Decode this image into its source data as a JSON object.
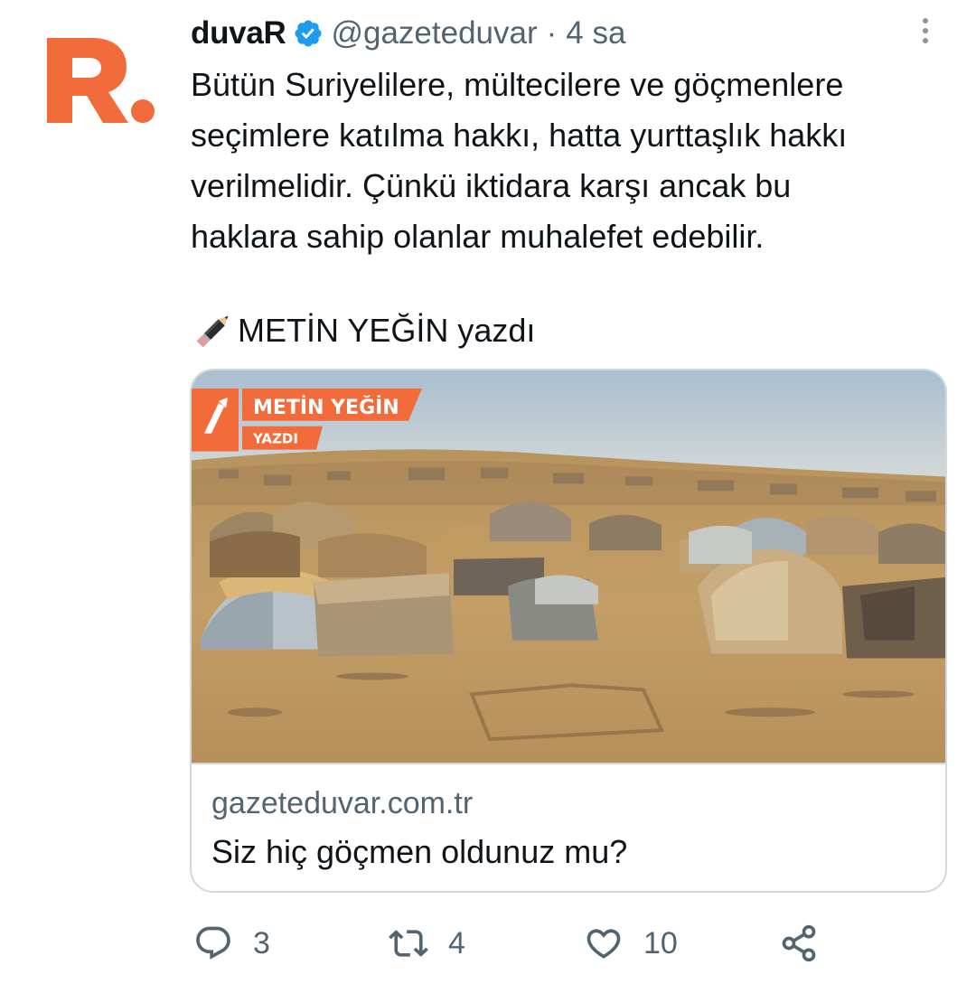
{
  "account": {
    "avatar_letter": "R.",
    "display_name": "duvaR",
    "handle": "@gazeteduvar",
    "separator": "·",
    "time": "4 sa",
    "verified_icon": "verified-badge-icon",
    "brand_color": "#f26b3a"
  },
  "tweet": {
    "text": "Bütün Suriyelilere, mültecilere ve göçmenlere\nseçimlere katılma hakkı, hatta yurttaşlık hakkı\nverilmelidir. Çünkü iktidara karşı ancak bu\nhaklara sahip olanlar muhalefet edebilir.",
    "byline_icon": "pencil-icon",
    "byline": "METİN YEĞİN yazdı"
  },
  "card": {
    "image_banner_name": "METİN YEĞİN",
    "image_banner_sub": "YAZDI",
    "domain": "gazeteduvar.com.tr",
    "title": "Siz hiç göçmen oldunuz mu?"
  },
  "actions": {
    "reply_count": "3",
    "retweet_count": "4",
    "like_count": "10",
    "icons": [
      "reply-icon",
      "retweet-icon",
      "like-icon",
      "share-icon"
    ]
  }
}
